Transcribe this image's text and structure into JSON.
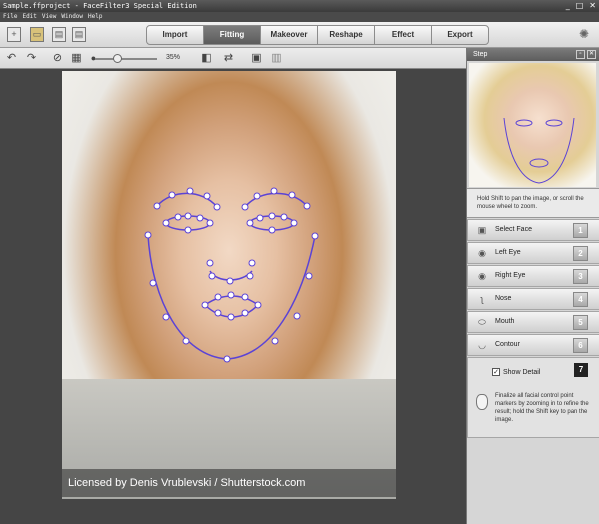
{
  "app": {
    "window_title": "Sample.ffproject - FaceFilter3 Special Edition",
    "window_buttons": [
      "_",
      "□",
      "✕"
    ]
  },
  "menu": [
    "File",
    "Edit",
    "View",
    "Window",
    "Help"
  ],
  "tabs": [
    {
      "label": "Import",
      "active": false
    },
    {
      "label": "Fitting",
      "active": true
    },
    {
      "label": "Makeover",
      "active": false
    },
    {
      "label": "Reshape",
      "active": false
    },
    {
      "label": "Effect",
      "active": false
    },
    {
      "label": "Export",
      "active": false
    }
  ],
  "toolbar": {
    "zoom_level": "35%",
    "zoom_fraction": 0.35
  },
  "canvas": {
    "license_text": "Licensed by Denis Vrublevski / Shutterstock.com"
  },
  "panel": {
    "title": "Step",
    "hint": "Hold Shift to pan the image, or scroll the mouse wheel to zoom.",
    "steps": [
      {
        "label": "Select Face",
        "num": "1",
        "icon": "select-face-icon"
      },
      {
        "label": "Left Eye",
        "num": "2",
        "icon": "eye-icon"
      },
      {
        "label": "Right Eye",
        "num": "3",
        "icon": "eye-icon"
      },
      {
        "label": "Nose",
        "num": "4",
        "icon": "nose-icon"
      },
      {
        "label": "Mouth",
        "num": "5",
        "icon": "mouth-icon"
      },
      {
        "label": "Contour",
        "num": "6",
        "icon": "contour-icon"
      }
    ],
    "detail": {
      "checkbox_label": "Show Detail",
      "checked": true,
      "num": "7",
      "description": "Finalize all facial control point markers by zooming in to refine the result; hold the Shift key to pan the image."
    }
  },
  "colors": {
    "contour_line": "#5b43d6",
    "marker_fill": "#ffffff",
    "active_tab": "#6a6a6a"
  }
}
